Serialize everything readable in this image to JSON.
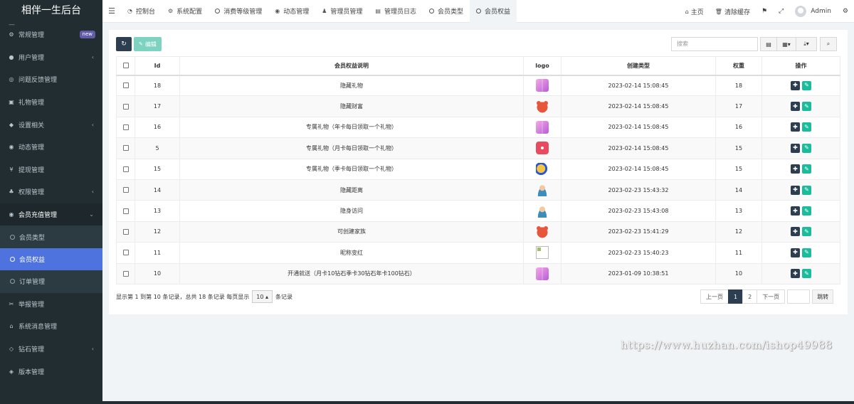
{
  "app": {
    "title": "相伴一生后台",
    "title_sub": "—"
  },
  "sidebar": {
    "items": [
      {
        "icon": "cogs-icon",
        "label": "常规管理",
        "badge": "new"
      },
      {
        "icon": "user-circle-icon",
        "label": "用户管理",
        "arrow": "‹"
      },
      {
        "icon": "feedback-icon",
        "label": "问题反馈管理"
      },
      {
        "icon": "gift-icon",
        "label": "礼物管理"
      },
      {
        "icon": "apple-icon",
        "label": "设置相关",
        "arrow": "‹"
      },
      {
        "icon": "dashboard-icon",
        "label": "动态管理"
      },
      {
        "icon": "yen-icon",
        "label": "提现管理"
      },
      {
        "icon": "users-icon",
        "label": "权限管理",
        "arrow": "‹"
      },
      {
        "icon": "dot-circle-icon",
        "label": "会员充值管理",
        "arrow": "⌄"
      }
    ],
    "sub_items": [
      {
        "label": "会员类型"
      },
      {
        "label": "会员权益"
      },
      {
        "label": "订单管理"
      }
    ],
    "items_after": [
      {
        "icon": "scissors-icon",
        "label": "举报管理"
      },
      {
        "icon": "bank-icon",
        "label": "系统消息管理"
      },
      {
        "icon": "diamond-icon",
        "label": "钻石管理",
        "arrow": "‹"
      },
      {
        "icon": "android-icon",
        "label": "版本管理"
      }
    ]
  },
  "topnav": {
    "tabs": [
      {
        "icon": "tachometer-icon",
        "label": "控制台"
      },
      {
        "icon": "cog-icon",
        "label": "系统配置"
      },
      {
        "icon": "circle-o-icon",
        "label": "消费等级管理"
      },
      {
        "icon": "dashboard-icon",
        "label": "动态管理"
      },
      {
        "icon": "user-icon",
        "label": "管理员管理"
      },
      {
        "icon": "list-alt-icon",
        "label": "管理员日志"
      },
      {
        "icon": "circle-o-icon",
        "label": "会员类型"
      },
      {
        "icon": "circle-o-icon",
        "label": "会员权益"
      }
    ],
    "home": "主页",
    "clear_cache": "清除缓存",
    "user": "Admin"
  },
  "toolbar": {
    "edit_label": "编辑",
    "search_placeholder": "搜索"
  },
  "table": {
    "headers": [
      "Id",
      "会员权益说明",
      "logo",
      "创建类型",
      "权重",
      "操作"
    ],
    "rows": [
      {
        "id": "18",
        "desc": "隐藏礼物",
        "logo": "gift",
        "created": "2023-02-14 15:08:45",
        "weight": "18"
      },
      {
        "id": "17",
        "desc": "隐藏财富",
        "logo": "bear",
        "created": "2023-02-14 15:08:45",
        "weight": "17"
      },
      {
        "id": "16",
        "desc": "专属礼物（年卡每日领取一个礼物）",
        "logo": "gift",
        "created": "2023-02-14 15:08:45",
        "weight": "16"
      },
      {
        "id": "5",
        "desc": "专属礼物（月卡每日领取一个礼物）",
        "logo": "dice",
        "created": "2023-02-14 15:08:45",
        "weight": "15"
      },
      {
        "id": "15",
        "desc": "专属礼物（季卡每日领取一个礼物）",
        "logo": "rocket",
        "created": "2023-02-14 15:08:45",
        "weight": "15"
      },
      {
        "id": "14",
        "desc": "隐藏距离",
        "logo": "person",
        "created": "2023-02-23 15:43:32",
        "weight": "14"
      },
      {
        "id": "13",
        "desc": "隐身访问",
        "logo": "person",
        "created": "2023-02-23 15:43:08",
        "weight": "13"
      },
      {
        "id": "12",
        "desc": "可创建家族",
        "logo": "bear",
        "created": "2023-02-23 15:41:29",
        "weight": "12"
      },
      {
        "id": "11",
        "desc": "昵称变红",
        "logo": "broken",
        "created": "2023-02-23 15:40:23",
        "weight": "11"
      },
      {
        "id": "10",
        "desc": "开通就送（月卡10钻石季卡30钻石年卡100钻石）",
        "logo": "gift",
        "created": "2023-01-09 10:38:51",
        "weight": "10"
      }
    ]
  },
  "footer": {
    "info": "显示第 1 到第 10 条记录，总共 18 条记录 每页显示",
    "page_size": "10",
    "page_size_suffix": "条记录"
  },
  "pager": {
    "prev": "上一页",
    "pages": [
      "1",
      "2"
    ],
    "current": "1",
    "next": "下一页",
    "go": "跳转"
  },
  "watermark": "https://www.huzhan.com/ishop49988"
}
